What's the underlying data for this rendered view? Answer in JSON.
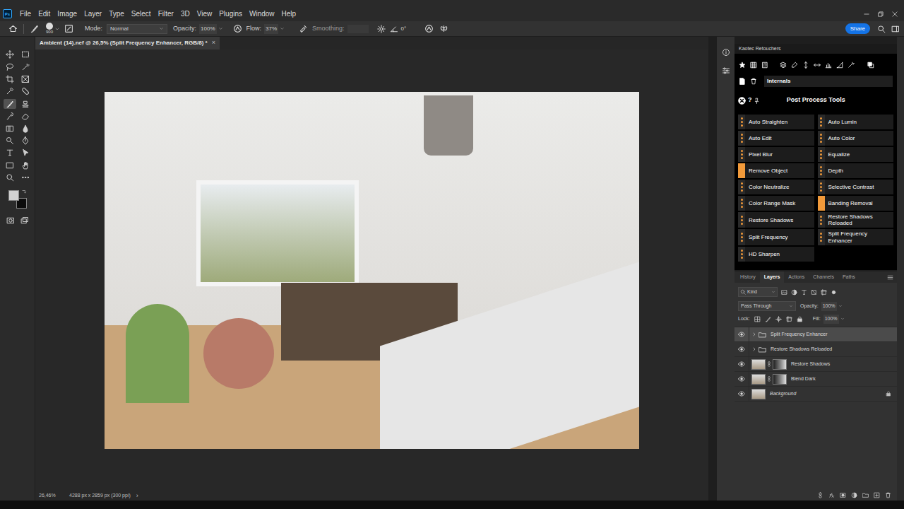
{
  "app": {
    "logo": "Ps"
  },
  "menu": [
    "File",
    "Edit",
    "Image",
    "Layer",
    "Type",
    "Select",
    "Filter",
    "3D",
    "View",
    "Plugins",
    "Window",
    "Help"
  ],
  "options_bar": {
    "brush_size": "900",
    "mode_label": "Mode:",
    "mode": "Normal",
    "opacity_label": "Opacity:",
    "opacity": "100%",
    "flow_label": "Flow:",
    "flow": "37%",
    "smoothing_label": "Smoothing:",
    "angle": "0°",
    "share": "Share"
  },
  "toolbar": {
    "tools": [
      {
        "selected": false
      },
      {
        "selected": false
      },
      {
        "selected": false
      },
      {
        "selected": false
      },
      {
        "selected": false
      },
      {
        "selected": false
      },
      {
        "selected": false
      },
      {
        "selected": false
      },
      {
        "selected": true
      },
      {
        "selected": false
      },
      {
        "selected": false
      },
      {
        "selected": false
      },
      {
        "selected": false
      },
      {
        "selected": false
      },
      {
        "selected": false
      },
      {
        "selected": false
      },
      {
        "selected": false
      },
      {
        "selected": false
      },
      {
        "selected": false
      },
      {
        "selected": false
      },
      {
        "selected": false
      },
      {
        "selected": false
      }
    ],
    "swatches": {
      "foreground": "#d2d2d2",
      "background": "#0c0c0c"
    }
  },
  "document": {
    "tab": "Ambient (14).nef @ 26,5% (Split Frequency Enhancer, RGB/8) *",
    "close": "×"
  },
  "status_bar": {
    "zoom": "26,46%",
    "size": "4288 px x 2859 px (300 ppi)",
    "arrow": "›"
  },
  "plugin_panel": {
    "title": "Kaotec Retouchers",
    "preset": "Internals",
    "help": "?",
    "section": "Post Process Tools",
    "tools": [
      {
        "label": "Auto Straighten",
        "highlighted": false
      },
      {
        "label": "Auto Lumin",
        "highlighted": false
      },
      {
        "label": "Auto Edit",
        "highlighted": false
      },
      {
        "label": "Auto Color",
        "highlighted": false
      },
      {
        "label": "Pixel Blur",
        "highlighted": false
      },
      {
        "label": "Equalize",
        "highlighted": false
      },
      {
        "label": "Remove Object",
        "highlighted": true
      },
      {
        "label": "Depth",
        "highlighted": false
      },
      {
        "label": "Color Neutralize",
        "highlighted": false
      },
      {
        "label": "Selective Contrast",
        "highlighted": false
      },
      {
        "label": "Color Range Mask",
        "highlighted": false
      },
      {
        "label": "Banding Removal",
        "highlighted": true
      },
      {
        "label": "Restore Shadows",
        "highlighted": false
      },
      {
        "label": "Restore Shadows Reloaded",
        "highlighted": false
      },
      {
        "label": "Split Frequency",
        "highlighted": false
      },
      {
        "label": "Split Frequency Enhancer",
        "highlighted": false
      },
      {
        "label": "HD Sharpen",
        "highlighted": false
      }
    ]
  },
  "layers_panel": {
    "tabs": [
      {
        "label": "History",
        "selected": false
      },
      {
        "label": "Layers",
        "selected": true
      },
      {
        "label": "Actions",
        "selected": false
      },
      {
        "label": "Channels",
        "selected": false
      },
      {
        "label": "Paths",
        "selected": false
      }
    ],
    "filter": "Kind",
    "blend_mode": "Pass Through",
    "opacity_label": "Opacity:",
    "opacity": "100%",
    "lock_label": "Lock:",
    "fill_label": "Fill:",
    "fill": "100%",
    "layers": [
      {
        "name": "Split Frequency Enhancer",
        "kind": "group",
        "visible": true,
        "selected": true,
        "mask": false,
        "locked": false
      },
      {
        "name": "Restore Shadows Reloaded",
        "kind": "group",
        "visible": true,
        "selected": false,
        "mask": false,
        "locked": false
      },
      {
        "name": "Restore Shadows",
        "kind": "layer",
        "visible": true,
        "selected": false,
        "mask": true,
        "locked": false
      },
      {
        "name": "Blend Dark",
        "kind": "layer",
        "visible": true,
        "selected": false,
        "mask": true,
        "locked": false
      },
      {
        "name": "Background",
        "kind": "background",
        "visible": true,
        "selected": false,
        "mask": false,
        "locked": true
      }
    ]
  }
}
